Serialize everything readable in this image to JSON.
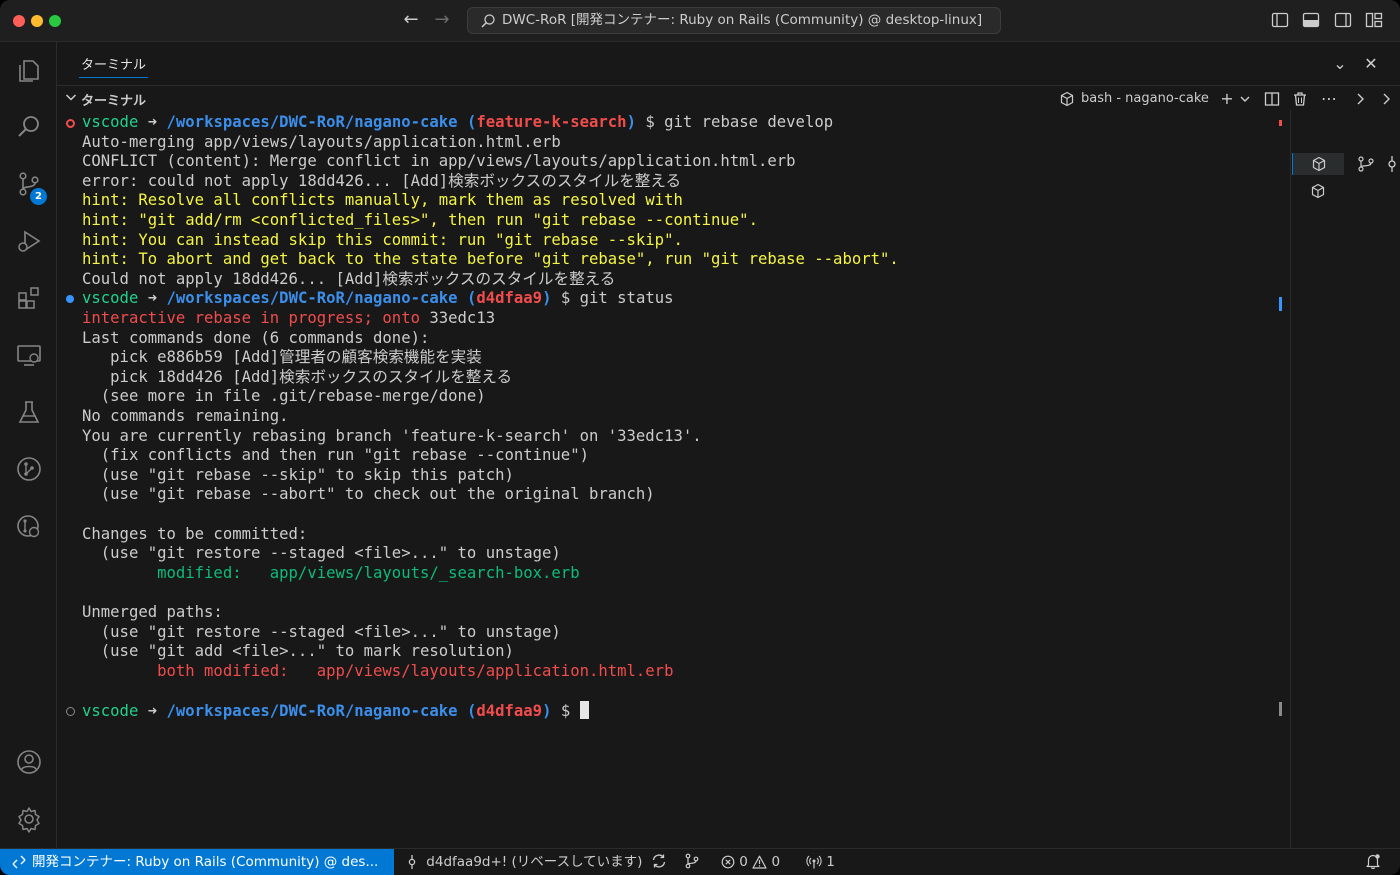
{
  "window": {
    "title": "DWC-RoR [開発コンテナー: Ruby on Rails (Community) @ desktop-linux]"
  },
  "panel": {
    "tab_label": "ターミナル",
    "section_label": "ターミナル",
    "terminal_instance": "bash - nagano-cake"
  },
  "activity": {
    "scm_badge": "2"
  },
  "terminal": {
    "lines": [
      {
        "segments": [
          {
            "t": "vscode",
            "c": "c-green"
          },
          {
            "t": " ➜ ",
            "c": "c-dim"
          },
          {
            "t": "/workspaces/DWC-RoR/nagano-cake",
            "c": "c-blue"
          },
          {
            "t": " (",
            "c": "c-blue"
          },
          {
            "t": "feature-k-search",
            "c": "c-bold-red"
          },
          {
            "t": ")",
            "c": "c-blue"
          },
          {
            "t": " $ git rebase develop",
            "c": "c-dim"
          }
        ],
        "deco": "err"
      },
      {
        "segments": [
          {
            "t": "Auto-merging app/views/layouts/application.html.erb",
            "c": "c-dim"
          }
        ]
      },
      {
        "segments": [
          {
            "t": "CONFLICT (content): Merge conflict in app/views/layouts/application.html.erb",
            "c": "c-dim"
          }
        ]
      },
      {
        "segments": [
          {
            "t": "error: could not apply 18dd426... [Add]検索ボックスのスタイルを整える",
            "c": "c-dim"
          }
        ]
      },
      {
        "segments": [
          {
            "t": "hint: Resolve all conflicts manually, mark them as resolved with",
            "c": "c-yellow"
          }
        ]
      },
      {
        "segments": [
          {
            "t": "hint: \"git add/rm <conflicted_files>\", then run \"git rebase --continue\".",
            "c": "c-yellow"
          }
        ]
      },
      {
        "segments": [
          {
            "t": "hint: You can instead skip this commit: run \"git rebase --skip\".",
            "c": "c-yellow"
          }
        ]
      },
      {
        "segments": [
          {
            "t": "hint: To abort and get back to the state before \"git rebase\", run \"git rebase --abort\".",
            "c": "c-yellow"
          }
        ]
      },
      {
        "segments": [
          {
            "t": "Could not apply 18dd426... [Add]検索ボックスのスタイルを整える",
            "c": "c-dim"
          }
        ]
      },
      {
        "segments": [
          {
            "t": "vscode",
            "c": "c-green"
          },
          {
            "t": " ➜ ",
            "c": "c-dim"
          },
          {
            "t": "/workspaces/DWC-RoR/nagano-cake",
            "c": "c-blue"
          },
          {
            "t": " (",
            "c": "c-blue"
          },
          {
            "t": "d4dfaa9",
            "c": "c-bold-red"
          },
          {
            "t": ")",
            "c": "c-blue"
          },
          {
            "t": " $ git status",
            "c": "c-dim"
          }
        ],
        "deco": "ok"
      },
      {
        "segments": [
          {
            "t": "interactive rebase in progress; onto ",
            "c": "c-red"
          },
          {
            "t": "33edc13",
            "c": "c-dim"
          }
        ]
      },
      {
        "segments": [
          {
            "t": "Last commands done (6 commands done):",
            "c": "c-dim"
          }
        ]
      },
      {
        "segments": [
          {
            "t": "   pick e886b59 [Add]管理者の顧客検索機能を実装",
            "c": "c-dim"
          }
        ]
      },
      {
        "segments": [
          {
            "t": "   pick 18dd426 [Add]検索ボックスのスタイルを整える",
            "c": "c-dim"
          }
        ]
      },
      {
        "segments": [
          {
            "t": "  (see more in file .git/rebase-merge/done)",
            "c": "c-dim"
          }
        ]
      },
      {
        "segments": [
          {
            "t": "No commands remaining.",
            "c": "c-dim"
          }
        ]
      },
      {
        "segments": [
          {
            "t": "You are currently rebasing branch 'feature-k-search' on '33edc13'.",
            "c": "c-dim"
          }
        ]
      },
      {
        "segments": [
          {
            "t": "  (fix conflicts and then run \"git rebase --continue\")",
            "c": "c-dim"
          }
        ]
      },
      {
        "segments": [
          {
            "t": "  (use \"git rebase --skip\" to skip this patch)",
            "c": "c-dim"
          }
        ]
      },
      {
        "segments": [
          {
            "t": "  (use \"git rebase --abort\" to check out the original branch)",
            "c": "c-dim"
          }
        ]
      },
      {
        "segments": [
          {
            "t": "",
            "c": "c-dim"
          }
        ]
      },
      {
        "segments": [
          {
            "t": "Changes to be committed:",
            "c": "c-dim"
          }
        ]
      },
      {
        "segments": [
          {
            "t": "  (use \"git restore --staged <file>...\" to unstage)",
            "c": "c-dim"
          }
        ]
      },
      {
        "segments": [
          {
            "t": "        modified:   app/views/layouts/_search-box.erb",
            "c": "c-green2"
          }
        ]
      },
      {
        "segments": [
          {
            "t": "",
            "c": "c-dim"
          }
        ]
      },
      {
        "segments": [
          {
            "t": "Unmerged paths:",
            "c": "c-dim"
          }
        ]
      },
      {
        "segments": [
          {
            "t": "  (use \"git restore --staged <file>...\" to unstage)",
            "c": "c-dim"
          }
        ]
      },
      {
        "segments": [
          {
            "t": "  (use \"git add <file>...\" to mark resolution)",
            "c": "c-dim"
          }
        ]
      },
      {
        "segments": [
          {
            "t": "        both modified:   app/views/layouts/application.html.erb",
            "c": "c-red"
          }
        ]
      },
      {
        "segments": [
          {
            "t": "",
            "c": "c-dim"
          }
        ]
      },
      {
        "segments": [
          {
            "t": "vscode",
            "c": "c-green"
          },
          {
            "t": " ➜ ",
            "c": "c-dim"
          },
          {
            "t": "/workspaces/DWC-RoR/nagano-cake",
            "c": "c-blue"
          },
          {
            "t": " (",
            "c": "c-blue"
          },
          {
            "t": "d4dfaa9",
            "c": "c-bold-red"
          },
          {
            "t": ")",
            "c": "c-blue"
          },
          {
            "t": " $ ",
            "c": "c-dim"
          }
        ],
        "deco": "idle",
        "cursor": true
      }
    ]
  },
  "statusbar": {
    "remote": "開発コンテナー: Ruby on Rails (Community) @ des...",
    "branch": "d4dfaa9d+! (リベースしています)",
    "errors": "0",
    "warnings": "0",
    "ports": "1"
  }
}
